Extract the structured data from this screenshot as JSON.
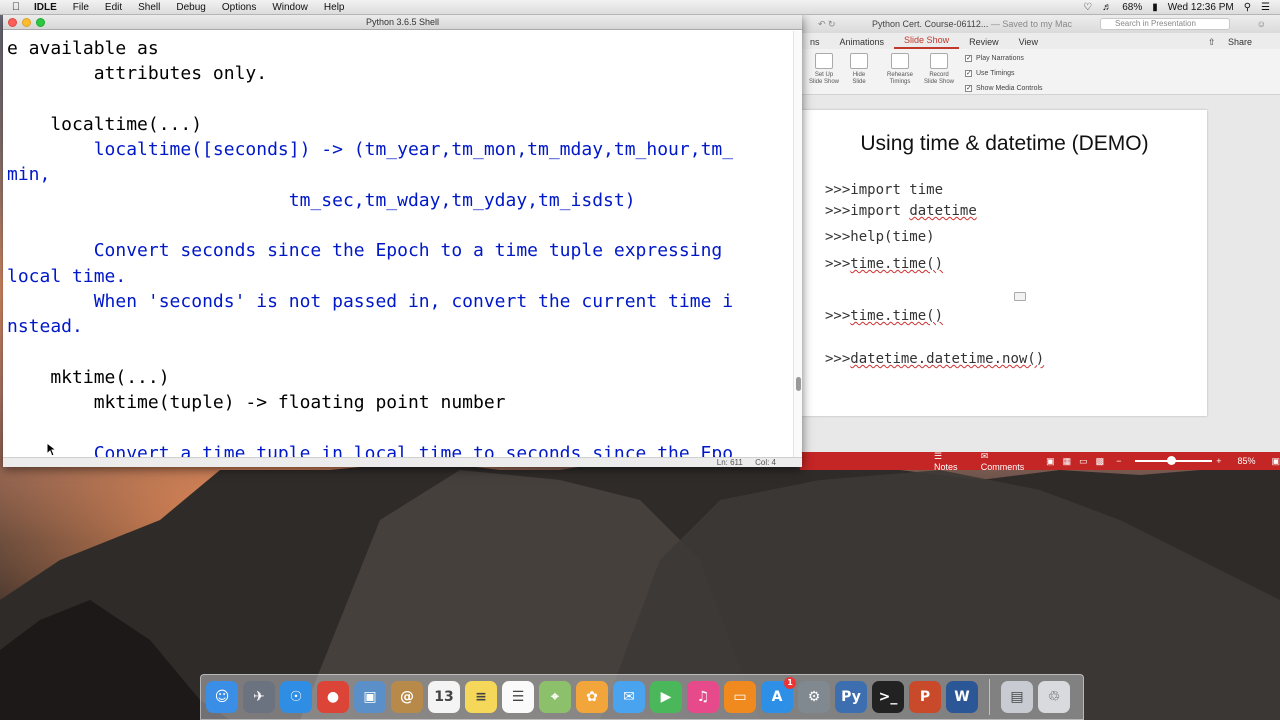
{
  "menubar": {
    "app": "IDLE",
    "items": [
      "File",
      "Edit",
      "Shell",
      "Debug",
      "Options",
      "Window",
      "Help"
    ],
    "battery": "68%",
    "clock": "Wed 12:36 PM"
  },
  "idle": {
    "title": "Python 3.6.5 Shell",
    "lines": [
      {
        "text": "e available as",
        "color": "black"
      },
      {
        "text": "        attributes only.",
        "color": "black"
      },
      {
        "text": "",
        "color": "black"
      },
      {
        "text": "    localtime(...)",
        "color": "black"
      },
      {
        "text": "        localtime([seconds]) -> (tm_year,tm_mon,tm_mday,tm_hour,tm_",
        "color": "blue"
      },
      {
        "text": "min,",
        "color": "blue"
      },
      {
        "text": "                          tm_sec,tm_wday,tm_yday,tm_isdst)",
        "color": "blue"
      },
      {
        "text": "",
        "color": "blue"
      },
      {
        "text": "        Convert seconds since the Epoch to a time tuple expressing",
        "color": "blue"
      },
      {
        "text": "local time.",
        "color": "blue"
      },
      {
        "text": "        When 'seconds' is not passed in, convert the current time i",
        "color": "blue"
      },
      {
        "text": "nstead.",
        "color": "blue"
      },
      {
        "text": "",
        "color": "blue"
      },
      {
        "text": "    mktime(...)",
        "color": "black"
      },
      {
        "text": "        mktime(tuple) -> floating point number",
        "color": "black"
      },
      {
        "text": "",
        "color": "black"
      },
      {
        "text": "        Convert a time tuple in local time to seconds since the Epo",
        "color": "blue"
      }
    ],
    "status_ln": "Ln: 611",
    "status_col": "Col: 4"
  },
  "ppt": {
    "doc_title": "Python Cert. Course-06112...",
    "saved": "— Saved to my Mac",
    "search_placeholder": "Search in Presentation",
    "tabs": [
      "ns",
      "Animations",
      "Slide Show",
      "Review",
      "View"
    ],
    "active_tab": "Slide Show",
    "share": "Share",
    "ribbon": {
      "setup": [
        "Set Up",
        "Slide Show"
      ],
      "hide": [
        "Hide",
        "Slide"
      ],
      "rehearse": [
        "Rehearse",
        "Timings"
      ],
      "record": [
        "Record",
        "Slide Show"
      ],
      "checks": [
        "Play Narrations",
        "Use Timings",
        "Show Media Controls"
      ]
    },
    "slide": {
      "title": "Using time & datetime (DEMO)",
      "lines": [
        {
          "prefix": ">>>",
          "code": "import time",
          "squig": ""
        },
        {
          "prefix": ">>>",
          "code": "import ",
          "squig": "datetime"
        },
        {
          "prefix": ">>>",
          "code": "help(time)",
          "squig": ""
        },
        {
          "prefix": ">>>",
          "code": "",
          "squig": "time.time()"
        },
        {
          "prefix": ">>>",
          "code": "",
          "squig": "time.time()"
        },
        {
          "prefix": ">>>",
          "code": "",
          "squig": "datetime.datetime.now()"
        }
      ]
    },
    "status": {
      "notes": "Notes",
      "comments": "Comments",
      "zoom": "85%"
    }
  },
  "dock": {
    "apps": [
      {
        "name": "Finder",
        "glyph": "☺",
        "color": "#3a8ee6"
      },
      {
        "name": "Launchpad",
        "glyph": "✈",
        "color": "#6b7380"
      },
      {
        "name": "Safari",
        "glyph": "☉",
        "color": "#2f8de4"
      },
      {
        "name": "Chrome",
        "glyph": "●",
        "color": "#db4437"
      },
      {
        "name": "Preview",
        "glyph": "▣",
        "color": "#5a8fc8"
      },
      {
        "name": "Contacts",
        "glyph": "@",
        "color": "#b88a4a"
      },
      {
        "name": "Calendar",
        "glyph": "13",
        "color": "#f4f4f4"
      },
      {
        "name": "Notes",
        "glyph": "≡",
        "color": "#f5d85a"
      },
      {
        "name": "Reminders",
        "glyph": "☰",
        "color": "#fafafa"
      },
      {
        "name": "Maps",
        "glyph": "⌖",
        "color": "#8cc06b"
      },
      {
        "name": "Photos",
        "glyph": "✿",
        "color": "#f2a53a"
      },
      {
        "name": "Messages",
        "glyph": "✉",
        "color": "#4aa3ef"
      },
      {
        "name": "FaceTime",
        "glyph": "▶",
        "color": "#4ab85a"
      },
      {
        "name": "iTunes",
        "glyph": "♫",
        "color": "#e64a8a"
      },
      {
        "name": "iBooks",
        "glyph": "▭",
        "color": "#f08a1e"
      },
      {
        "name": "App Store",
        "glyph": "A",
        "color": "#2e8fe6",
        "badge": "1"
      },
      {
        "name": "System Preferences",
        "glyph": "⚙",
        "color": "#808890"
      },
      {
        "name": "Python",
        "glyph": "Py",
        "color": "#3d6fb0"
      },
      {
        "name": "Terminal",
        "glyph": ">_",
        "color": "#222222"
      },
      {
        "name": "PowerPoint",
        "glyph": "P",
        "color": "#c94a2a"
      },
      {
        "name": "Word",
        "glyph": "W",
        "color": "#2b5797"
      }
    ],
    "right": [
      {
        "name": "Downloads",
        "glyph": "▤",
        "color": "#c8ccd2"
      },
      {
        "name": "Trash",
        "glyph": "♲",
        "color": "#d8dadd"
      }
    ]
  }
}
